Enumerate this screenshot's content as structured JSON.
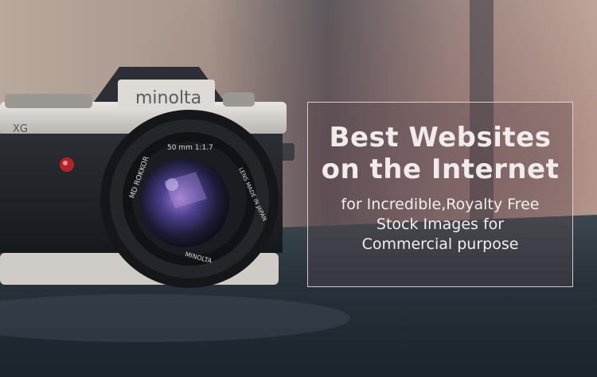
{
  "image": {
    "subject": "vintage-camera",
    "camera_brand_text": "minolta",
    "lens_texts": [
      "MD ROKKOR",
      "50 mm 1:1.7",
      "LENS MADE IN JAPAN",
      "MINOLTA"
    ],
    "model_text": "XG"
  },
  "banner": {
    "headline_line1": "Best Websites",
    "headline_line2": "on the Internet",
    "sub_line1": "for Incredible,Royalty Free",
    "sub_line2": "Stock Images for",
    "sub_line3": "Commercial purpose"
  }
}
